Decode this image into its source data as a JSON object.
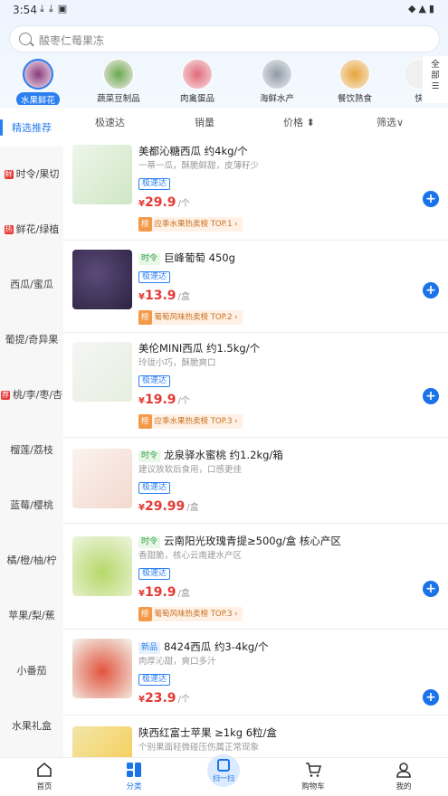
{
  "status_bar": {
    "time": "3:54"
  },
  "search": {
    "placeholder": "酸枣仁莓果冻"
  },
  "categories": [
    {
      "label": "水果鲜花",
      "selected": true
    },
    {
      "label": "蔬菜豆制品"
    },
    {
      "label": "肉禽蛋品"
    },
    {
      "label": "海鲜水产"
    },
    {
      "label": "餐饮熟食"
    },
    {
      "label": "快"
    }
  ],
  "all_categories_label": "全部",
  "sidebar": [
    {
      "label": "精选推荐",
      "active": true
    },
    {
      "label": "时令/果切",
      "tag": "鲜"
    },
    {
      "label": "鲜花/绿植",
      "tag": "热"
    },
    {
      "label": "西瓜/蜜瓜"
    },
    {
      "label": "葡提/奇异果"
    },
    {
      "label": "桃/李/枣/杏",
      "tag": "荐"
    },
    {
      "label": "榴莲/荔枝"
    },
    {
      "label": "蓝莓/樱桃"
    },
    {
      "label": "橘/橙/柚/柠"
    },
    {
      "label": "苹果/梨/蕉"
    },
    {
      "label": "小番茄"
    },
    {
      "label": "水果礼盒"
    }
  ],
  "sort_bar": {
    "express": "极速达",
    "sales": "销量",
    "price": "价格 ⬍",
    "filter": "筛选∨"
  },
  "products": [
    {
      "tag": "",
      "name": "美都沁糖西瓜 约4kg/个",
      "subtitle": "一蒂一瓜，酥脆鲜甜，皮薄籽少",
      "express": "极速达",
      "price": "29.9",
      "unit": "/个",
      "rank": "应季水果热卖榜 TOP.1 ›"
    },
    {
      "tag": "时令",
      "name": "巨峰葡萄 450g",
      "subtitle": "",
      "express": "极速达",
      "price": "13.9",
      "unit": "/盒",
      "rank": "葡萄风味热卖榜 TOP.2 ›"
    },
    {
      "tag": "",
      "name": "美伦MINI西瓜 约1.5kg/个",
      "subtitle": "玲珑小巧，酥脆爽口",
      "express": "极速达",
      "price": "19.9",
      "unit": "/个",
      "rank": "应季水果热卖榜 TOP.3 ›"
    },
    {
      "tag": "时令",
      "name": "龙泉驿水蜜桃 约1.2kg/箱",
      "subtitle": "建议放软后食用，口感更佳",
      "express": "极速达",
      "price": "29.99",
      "unit": "/盒",
      "rank": ""
    },
    {
      "tag": "时令",
      "name": "云南阳光玫瑰青提≥500g/盒 核心产区",
      "subtitle": "香甜脆，核心云南建水产区",
      "express": "极速达",
      "price": "19.9",
      "unit": "/盒",
      "rank": "葡萄风味热卖榜 TOP.3 ›"
    },
    {
      "tag": "新品",
      "name": "8424西瓜 约3-4kg/个",
      "subtitle": "肉厚沁甜，爽口多汁",
      "express": "极速达",
      "price": "23.9",
      "unit": "/个",
      "rank": ""
    },
    {
      "tag": "",
      "name": "陕西红富士苹果 ≥1kg 6粒/盒",
      "subtitle": "个别果面轻微碰压伤属正常现象",
      "express": "",
      "price": "",
      "unit": "",
      "rank": ""
    }
  ],
  "rank_badge": "榜",
  "currency": "¥",
  "tab_bar": [
    {
      "label": "首页",
      "icon": "home-icon"
    },
    {
      "label": "分类",
      "icon": "category-icon",
      "active": true
    },
    {
      "label": "扫一扫",
      "icon": "scan-icon"
    },
    {
      "label": "购物车",
      "icon": "cart-icon"
    },
    {
      "label": "我的",
      "icon": "profile-icon"
    }
  ],
  "colors": {
    "accent": "#1a73e8",
    "price": "#e53935",
    "rank": "#f39a4a"
  }
}
